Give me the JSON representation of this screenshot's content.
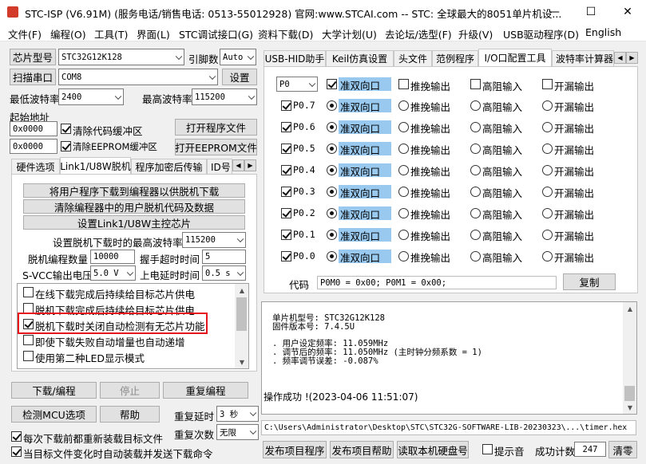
{
  "window": {
    "title": "STC-ISP (V6.91M) (服务电话/销售电话: 0513-55012928) 官网:www.STCAI.com  -- STC: 全球最大的8051单片机设...",
    "minimize": "—",
    "maximize": "☐",
    "close": "✕"
  },
  "menu": [
    "文件(F)",
    "编程(O)",
    "工具(T)",
    "界面(L)",
    "STC调试接口(G)",
    "资料下载(D)",
    "大学计划(U)",
    "去论坛/选型(F)",
    "升级(V)",
    "USB驱动程序(D)",
    "English"
  ],
  "left": {
    "chip_type_btn": "芯片型号",
    "chip_type": "STC32G12K128",
    "pin_label": "引脚数",
    "pin_value": "Auto",
    "scan_port_btn": "扫描串口",
    "port": "COM8",
    "settings_btn": "设置",
    "min_baud_label": "最低波特率",
    "min_baud": "2400",
    "max_baud_label": "最高波特率",
    "max_baud": "115200",
    "start_addr_label": "起始地址",
    "addr1": "0x0000",
    "clear_code_label": "清除代码缓冲区",
    "open_prog_btn": "打开程序文件",
    "addr2": "0x0000",
    "clear_eeprom_label": "清除EEPROM缓冲区",
    "open_eeprom_btn": "打开EEPROM文件",
    "tabs": [
      "硬件选项",
      "Link1/U8W脱机",
      "程序加密后传输",
      "ID号"
    ],
    "offline": {
      "btn1": "将用户程序下载到编程器以供脱机下载",
      "btn2": "清除编程器中的用户脱机代码及数据",
      "btn3": "设置Link1/U8W主控芯片",
      "max_baud_label": "设置脱机下载时的最高波特率",
      "max_baud": "115200",
      "count_label": "脱机编程数量",
      "count": "10000",
      "handshake_label": "握手超时时间",
      "handshake": "5",
      "svcc_label": "S-VCC输出电压",
      "svcc": "5.0 V",
      "power_delay_label": "上电延时时间",
      "power_delay": "0.5 s",
      "options": [
        "在线下载完成后持续给目标芯片供电",
        "脱机下载完成后持续给目标芯片供电",
        "脱机下载时关闭自动检测有无芯片功能",
        "即使下载失败自动增量也自动递增",
        "使用第二种LED显示模式"
      ]
    },
    "download_btn": "下载/编程",
    "stop_btn": "停止",
    "reprogram_btn": "重复编程",
    "detect_btn": "检测MCU选项",
    "help_btn": "帮助",
    "repeat_delay_label": "重复延时",
    "repeat_delay": "3 秒",
    "repeat_count_label": "重复次数",
    "repeat_count": "无限",
    "reload_label": "每次下载前都重新装载目标文件",
    "auto_load_label": "当目标文件变化时自动装载并发送下载命令"
  },
  "right": {
    "tabs": [
      "USB-HID助手",
      "Keil仿真设置",
      "头文件",
      "范例程序",
      "I/O口配置工具",
      "波特率计算器"
    ],
    "port_select": "P0",
    "header_modes": [
      "准双向口",
      "推挽输出",
      "高阻输入",
      "开漏输出"
    ],
    "pins": [
      "P0.7",
      "P0.6",
      "P0.5",
      "P0.4",
      "P0.3",
      "P0.2",
      "P0.1",
      "P0.0"
    ],
    "modes": [
      "准双向口",
      "推挽输出",
      "高阻输入",
      "开漏输出"
    ],
    "code_label": "代码",
    "code_value": "P0M0 = 0x00; P0M1 = 0x00;",
    "copy_btn": "复制",
    "log": {
      "line1": "单片机型号: STC32G12K128",
      "line2": "固件版本号: 7.4.5U",
      "line3": ". 用户设定频率: 11.059MHz",
      "line4": ". 调节后的频率: 11.050MHz (主时钟分频系数 = 1)",
      "line5": ". 频率调节误差: -0.087%",
      "line6": "操作成功 !(2023-04-06 11:51:07)"
    },
    "path": "C:\\Users\\Administrator\\Desktop\\STC\\STC32G-SOFTWARE-LIB-20230323\\...\\timer.hex",
    "publish_btn": "发布项目程序",
    "publish_help_btn": "发布项目帮助",
    "read_disk_btn": "读取本机硬盘号",
    "beep_label": "提示音",
    "success_label": "成功计数",
    "success_count": "247",
    "clear_btn": "清零"
  },
  "colors": {
    "highlight": "#99c9ef",
    "red_box": "#e8141c"
  }
}
